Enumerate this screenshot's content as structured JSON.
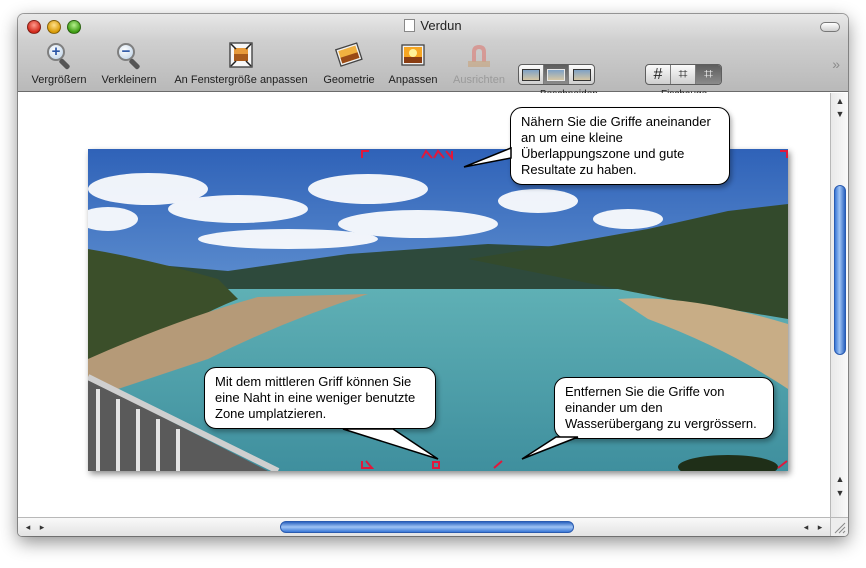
{
  "window": {
    "title": "Verdun"
  },
  "toolbar": {
    "tools": [
      {
        "id": "zoom-in",
        "label": "Vergrößern"
      },
      {
        "id": "zoom-out",
        "label": "Verkleinern"
      },
      {
        "id": "fit",
        "label": "An Fenstergröße anpassen"
      },
      {
        "id": "geometry",
        "label": "Geometrie"
      },
      {
        "id": "adjust",
        "label": "Anpassen"
      },
      {
        "id": "align",
        "label": "Ausrichten",
        "disabled": true
      }
    ],
    "crop_label": "Beschneiden",
    "fisheye_label": "Fischauge"
  },
  "callouts": {
    "top": "Nähern Sie die Griffe aneinander an um eine kleine Überlappungszone und gute Resultate zu haben.",
    "bottom_left": "Mit dem mittleren Griff können Sie eine Naht in eine weniger benutzte Zone umplatzieren.",
    "bottom_right": "Entfernen Sie die Griffe von einander um den Wasserübergang zu vergrössern."
  },
  "colors": {
    "handle": "#e0183c",
    "scroll_accent": "#3a77d6"
  }
}
